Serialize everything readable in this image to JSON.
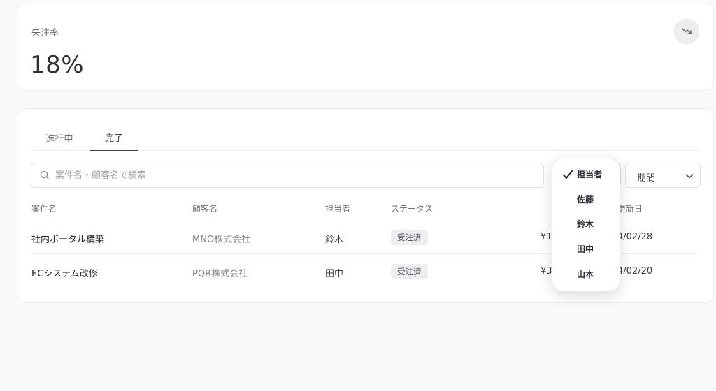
{
  "stat": {
    "label": "失注率",
    "value": "18%"
  },
  "tabs": [
    {
      "label": "進行中",
      "active": false
    },
    {
      "label": "完了",
      "active": true
    }
  ],
  "search": {
    "placeholder": "案件名・顧客名で検索",
    "value": ""
  },
  "filters": {
    "owner_selected": "担当者",
    "period_label": "期間"
  },
  "table": {
    "headers": {
      "project": "案件名",
      "customer": "顧客名",
      "owner": "担当者",
      "status": "ステータス",
      "updated": "更新日"
    },
    "rows": [
      {
        "project": "社内ポータル構築",
        "customer": "MNO株式会社",
        "owner": "鈴木",
        "status": "受注済",
        "amount": "¥1,",
        "updated": "4/02/28"
      },
      {
        "project": "ECシステム改修",
        "customer": "PQR株式会社",
        "owner": "田中",
        "status": "受注済",
        "amount": "¥3,",
        "updated": "4/02/20"
      }
    ]
  },
  "owner_dropdown": {
    "options": [
      {
        "label": "担当者",
        "selected": true
      },
      {
        "label": "佐藤",
        "selected": false
      },
      {
        "label": "鈴木",
        "selected": false
      },
      {
        "label": "田中",
        "selected": false
      },
      {
        "label": "山本",
        "selected": false
      }
    ]
  },
  "colors": {
    "accent": "#3a3e45",
    "badge_bg": "#eeeef0",
    "muted_text": "#6b6f76"
  }
}
